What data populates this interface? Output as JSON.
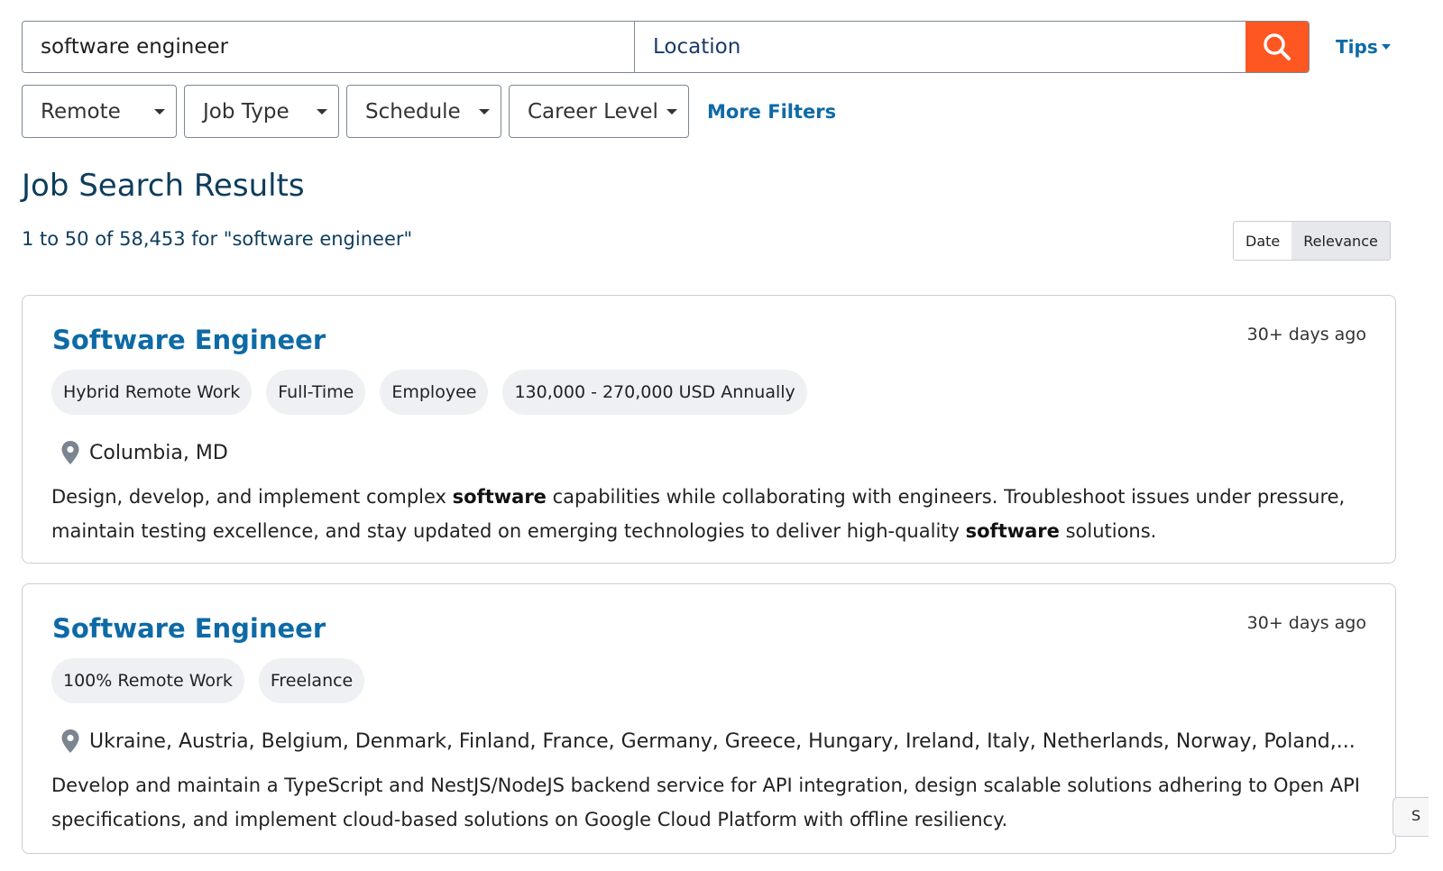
{
  "search": {
    "query_value": "software engineer",
    "location_placeholder": "Location",
    "tips_label": "Tips"
  },
  "filters": {
    "items": [
      {
        "label": "Remote"
      },
      {
        "label": "Job Type"
      },
      {
        "label": "Schedule"
      },
      {
        "label": "Career Level"
      }
    ],
    "more_label": "More Filters"
  },
  "results": {
    "title": "Job Search Results",
    "count_text": "1 to 50 of 58,453 for \"software engineer\"",
    "sort": {
      "options": [
        "Date",
        "Relevance"
      ],
      "selected": "Relevance"
    }
  },
  "jobs": [
    {
      "title": "Software Engineer",
      "posted": "30+ days ago",
      "tags": [
        "Hybrid Remote Work",
        "Full-Time",
        "Employee",
        "130,000 - 270,000 USD Annually"
      ],
      "location": "Columbia, MD",
      "description": [
        {
          "text": "Design, develop, and implement complex ",
          "bold": false
        },
        {
          "text": "software",
          "bold": true
        },
        {
          "text": " capabilities while collaborating with engineers. Troubleshoot issues under pressure, maintain testing excellence, and stay updated on emerging technologies to deliver high-quality ",
          "bold": false
        },
        {
          "text": "software",
          "bold": true
        },
        {
          "text": " solutions.",
          "bold": false
        }
      ]
    },
    {
      "title": "Software Engineer",
      "posted": "30+ days ago",
      "tags": [
        "100% Remote Work",
        "Freelance"
      ],
      "location": "Ukraine, Austria, Belgium, Denmark, Finland, France, Germany, Greece, Hungary, Ireland, Italy, Netherlands, Norway, Poland,...",
      "description": [
        {
          "text": "Develop and maintain a TypeScript and NestJS/NodeJS backend service for API integration, design scalable solutions adhering to Open API specifications, and implement cloud-based solutions on Google Cloud Platform with offline resiliency.",
          "bold": false
        }
      ]
    }
  ],
  "side_tab_label": "S",
  "colors": {
    "accent": "#0e6aa6",
    "search_button": "#ff5722",
    "heading": "#0d3d5c",
    "tag_bg": "#eef0f3"
  },
  "icons": {
    "search": "magnifier-icon",
    "location": "map-pin-icon",
    "dropdown": "caret-down-icon"
  }
}
